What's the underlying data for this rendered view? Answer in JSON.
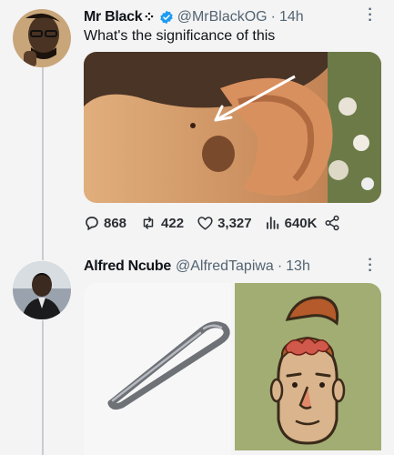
{
  "tweet1": {
    "display_name": "Mr Black",
    "name_glyph": "⁘",
    "handle": "@MrBlackOG",
    "separator": "·",
    "time": "14h",
    "text": "What's the significance of this",
    "verified_color": "#1d9bf0",
    "actions": {
      "replies": "868",
      "retweets": "422",
      "likes": "3,327",
      "views": "640K"
    }
  },
  "tweet2": {
    "display_name": "Alfred Ncube",
    "handle": "@AlfredTapiwa",
    "separator": "·",
    "time": "13h"
  },
  "icons": [
    "verified-badge-icon",
    "more-icon",
    "reply-icon",
    "retweet-icon",
    "like-icon",
    "views-icon",
    "share-icon"
  ],
  "colors": {
    "muted": "#536471",
    "thread_line": "#c9ccd0",
    "background": "#f4f4f5"
  }
}
